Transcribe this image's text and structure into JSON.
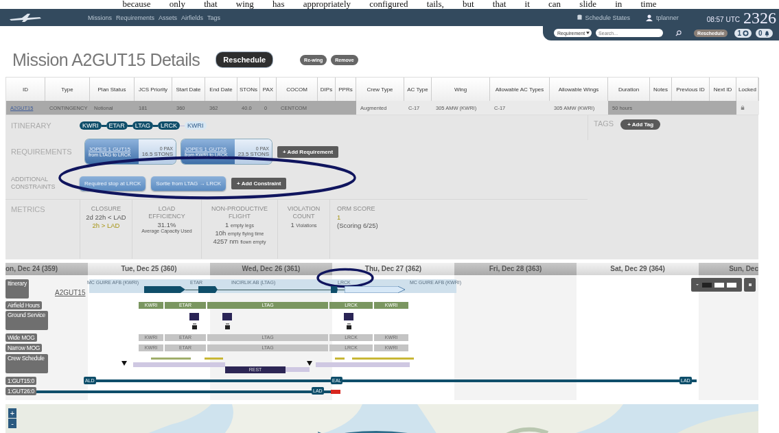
{
  "caption": "because only that wing has appropriately configured tails, but that it can slide in time",
  "nav": {
    "links": [
      "Missions",
      "Requirements",
      "Assets",
      "Airfields",
      "Tags"
    ],
    "schedule_states": "Schedule States",
    "user": "tplanner",
    "time": "08:57 UTC",
    "day": "2326"
  },
  "toolbar": {
    "filter": "Requirement",
    "search_placeholder": "Search...",
    "reschedule": "Reschedule",
    "counters": [
      {
        "count": "1",
        "kind": "info"
      },
      {
        "count": "0",
        "kind": "alert"
      }
    ]
  },
  "title": "Mission A2GUT15 Details",
  "actions": [
    {
      "label": "Reschedule",
      "kind": "primary"
    },
    {
      "label": "Re-wing",
      "kind": "small"
    },
    {
      "label": "Remove",
      "kind": "small"
    }
  ],
  "table": {
    "columns": [
      "ID",
      "Type",
      "Plan Status",
      "JCS Priority",
      "Start Date",
      "End Date",
      "STONs",
      "PAX",
      "COCOM",
      "DIPs",
      "PPRs",
      "Crew Type",
      "AC Type",
      "Wing",
      "Allowable AC Types",
      "Allowable Wings",
      "Duration",
      "Notes",
      "Previous ID",
      "Next ID",
      "Locked"
    ],
    "rows": [
      {
        "cells": [
          {
            "kind": "link",
            "text": "A2GUT15",
            "shaded": true
          },
          {
            "kind": "text",
            "text": "CONTINGENCY",
            "shaded": true
          },
          {
            "kind": "text",
            "text": "Notional",
            "shaded": true
          },
          {
            "kind": "text",
            "text": "181",
            "shaded": true
          },
          {
            "kind": "text",
            "text": "360",
            "shaded": true
          },
          {
            "kind": "text",
            "text": "362",
            "shaded": true
          },
          {
            "kind": "text",
            "text": "40.0",
            "shaded": true
          },
          {
            "kind": "text",
            "text": "0",
            "shaded": true
          },
          {
            "kind": "text",
            "text": "CENTCOM",
            "shaded": true
          },
          {
            "kind": "text",
            "shaded": true
          },
          {
            "kind": "text",
            "shaded": true
          },
          {
            "kind": "text",
            "text": "Augmented",
            "shaded": false
          },
          {
            "kind": "text",
            "text": "C-17",
            "shaded": false
          },
          {
            "kind": "text",
            "text": "305 AMW (KWRI)",
            "shaded": false
          },
          {
            "kind": "text",
            "text": "C-17",
            "shaded": false
          },
          {
            "kind": "text",
            "text": "305 AMW (KWRI)",
            "shaded": false
          },
          {
            "kind": "text",
            "text": "50 hours",
            "shaded": true
          },
          {
            "kind": "text",
            "shaded": true
          },
          {
            "kind": "text",
            "shaded": true
          },
          {
            "kind": "text",
            "shaded": true
          },
          {
            "kind": "lock",
            "shaded": false
          }
        ]
      }
    ]
  },
  "itinerary": {
    "label": "ITINERARY",
    "stops": [
      {
        "code": "KWRI",
        "kind": "flown"
      },
      {
        "code": "ETAR",
        "kind": "flown"
      },
      {
        "code": "LTAG",
        "kind": "flown"
      },
      {
        "code": "LRCK",
        "kind": "flown"
      },
      {
        "code": "KWRI",
        "kind": "planned"
      }
    ]
  },
  "requirements": {
    "label": "REQUIREMENTS",
    "items": [
      {
        "id": "JOPES 1 GUT15",
        "route": "from LTAG to LRCK",
        "pax": "0 PAX",
        "stons": "16.5 STONS"
      },
      {
        "id": "JOPES 1 GUT26",
        "route": "from KWRI to LRCK",
        "pax": "0 PAX",
        "stons": "23.5 STONS"
      }
    ],
    "add": "+ Add Requirement"
  },
  "constraints": {
    "label": "ADDITIONAL CONSTRAINTS",
    "items": [
      "Required stop at LRCK",
      "Sortie from LTAG → LRCK"
    ],
    "add": "+ Add Constraint"
  },
  "metrics": {
    "label": "METRICS",
    "items": [
      {
        "title": "CLOSURE",
        "lines": [
          {
            "kind": "value",
            "text": "2d 22h < LAD"
          },
          {
            "kind": "warn",
            "text": "2h > LAD"
          }
        ]
      },
      {
        "title": "LOAD EFFICIENCY",
        "lines": [
          {
            "kind": "value",
            "text": "31.1%"
          },
          {
            "kind": "note",
            "text": "Average Capacity Used"
          }
        ]
      },
      {
        "title": "NON-PRODUCTIVE FLIGHT",
        "lines": [
          {
            "kind": "pair",
            "text": "1",
            "unit": "empty legs"
          },
          {
            "kind": "pair",
            "text": "10h",
            "unit": "empty flying time"
          },
          {
            "kind": "pair",
            "text": "4257 nm",
            "unit": "flown empty"
          }
        ]
      },
      {
        "title": "VIOLATION COUNT",
        "lines": [
          {
            "kind": "pair",
            "text": "1",
            "unit": "Violations"
          }
        ]
      },
      {
        "title": "ORM SCORE",
        "lines": [
          {
            "kind": "warn",
            "text": "1"
          },
          {
            "kind": "value",
            "text": "(Scoring 6/25)"
          }
        ]
      }
    ]
  },
  "tags": {
    "label": "TAGS",
    "add": "+ Add Tag"
  },
  "timeline": {
    "days": [
      {
        "label": "on, Dec 24 (359)",
        "shaded": true
      },
      {
        "label": "Tue, Dec 25 (360)",
        "shaded": false
      },
      {
        "label": "Wed, Dec 26 (361)",
        "shaded": true
      },
      {
        "label": "Thu, Dec 27 (362)",
        "shaded": false
      },
      {
        "label": "Fri, Dec 28 (363)",
        "shaded": true
      },
      {
        "label": "Sat, Dec 29 (364)",
        "shaded": false
      },
      {
        "label": "Sun, Dec",
        "shaded": true
      }
    ],
    "mission": "A2GUT15",
    "rows": [
      {
        "label": "Itinerary",
        "kind": "itinerary",
        "places": [
          "MC GUIRE AFB (KWRI)",
          "ETAR",
          "INCIRLIK AB (LTAG)",
          "LRCK",
          "MC GUIRE AFB (KWRI)"
        ],
        "legs": [
          {
            "kind": "flown"
          },
          {
            "kind": "flown"
          },
          {
            "kind": "flown"
          },
          {
            "kind": "planned"
          }
        ]
      },
      {
        "label": "Airfield Hours",
        "kind": "hours",
        "segments": [
          "KWRI",
          "ETAR",
          "LTAG",
          "LRCK",
          "KWRI"
        ]
      },
      {
        "label": "Ground Service",
        "kind": "ground"
      },
      {
        "label": "Wide MOG",
        "kind": "mog",
        "segments": [
          "KWRI",
          "ETAR",
          "LTAG",
          "LRCK",
          "KWRI"
        ]
      },
      {
        "label": "Narrow MOG",
        "kind": "mog",
        "segments": [
          "KWRI",
          "ETAR",
          "LTAG",
          "LRCK",
          "KWRI"
        ]
      },
      {
        "label": "Crew Schedule",
        "kind": "crew",
        "rest": "REST"
      },
      {
        "label": "1:GUT15:0",
        "kind": "requirement",
        "markers": [
          "ALD",
          "EAL",
          "LAD"
        ]
      },
      {
        "label": "1:GUT26:0",
        "kind": "requirement",
        "markers": [
          "LAD"
        ]
      }
    ]
  },
  "map": {
    "zoom_in": "+",
    "zoom_out": "-"
  }
}
